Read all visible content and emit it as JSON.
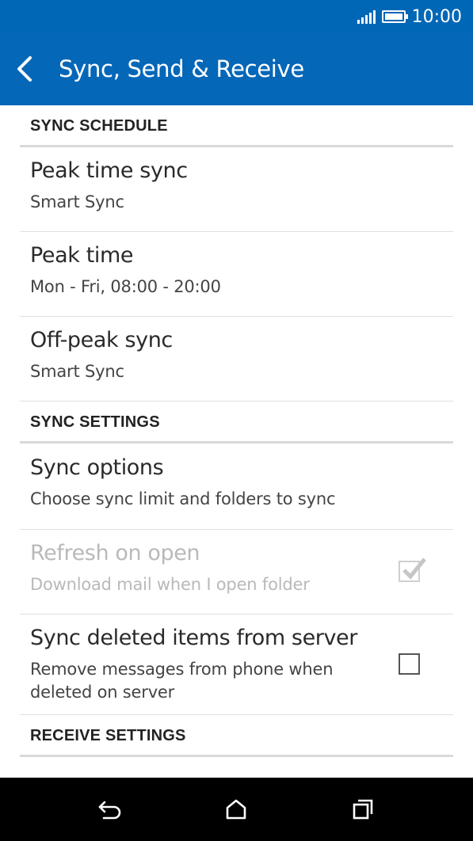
{
  "status_bar": {
    "time": "10:00",
    "icons": [
      "signal-icon",
      "battery-icon"
    ]
  },
  "app_bar": {
    "title": "Sync, Send & Receive",
    "back_icon": "chevron-left-icon"
  },
  "sections": {
    "sync_schedule": {
      "header": "SYNC SCHEDULE",
      "peak_time_sync": {
        "title": "Peak time sync",
        "subtitle": "Smart Sync"
      },
      "peak_time": {
        "title": "Peak time",
        "subtitle": "Mon - Fri, 08:00 - 20:00"
      },
      "off_peak_sync": {
        "title": "Off-peak sync",
        "subtitle": "Smart Sync"
      }
    },
    "sync_settings": {
      "header": "SYNC SETTINGS",
      "sync_options": {
        "title": "Sync options",
        "subtitle": "Choose sync limit and folders to sync"
      },
      "refresh_on_open": {
        "title": "Refresh on open",
        "subtitle": "Download mail when I open folder",
        "checked": true,
        "enabled": false
      },
      "sync_deleted": {
        "title": "Sync deleted items from server",
        "subtitle": "Remove messages from phone when deleted on server",
        "checked": false,
        "enabled": true
      }
    },
    "receive_settings": {
      "header": "RECEIVE SETTINGS"
    }
  },
  "nav_bar": {
    "icons": [
      "back-icon",
      "home-icon",
      "recent-apps-icon"
    ]
  },
  "colors": {
    "app_bar": "#0567b8",
    "status_bar": "#0067b6"
  }
}
